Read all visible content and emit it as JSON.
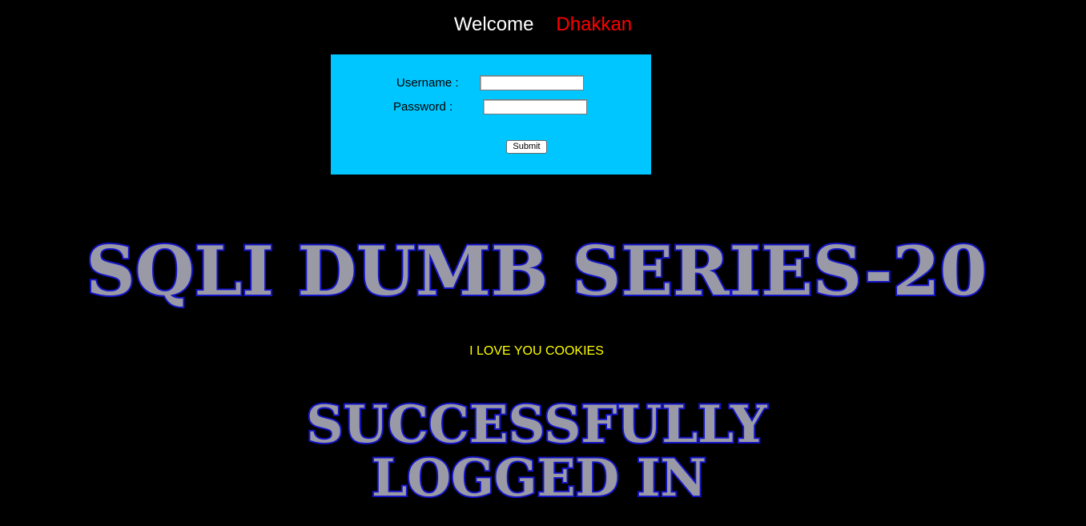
{
  "welcome": {
    "greeting": "Welcome",
    "name": "Dhakkan"
  },
  "login_form": {
    "username_label": "Username :",
    "password_label": "Password :",
    "username_value": "",
    "password_value": "",
    "submit_label": "Submit"
  },
  "banner": {
    "series_title": "SQLI DUMB SERIES-20",
    "success_line1": "SUCCESSFULLY",
    "success_line2": "LOGGED IN"
  },
  "cookie_message": "I LOVE YOU COOKIES",
  "colors": {
    "background": "#000000",
    "form_background": "#00c6ff",
    "welcome_text": "#ffffff",
    "name_text": "#ff0000",
    "cookie_text": "#ffff00",
    "banner_fill": "#9a9aa6",
    "banner_outline": "#1515c8"
  }
}
